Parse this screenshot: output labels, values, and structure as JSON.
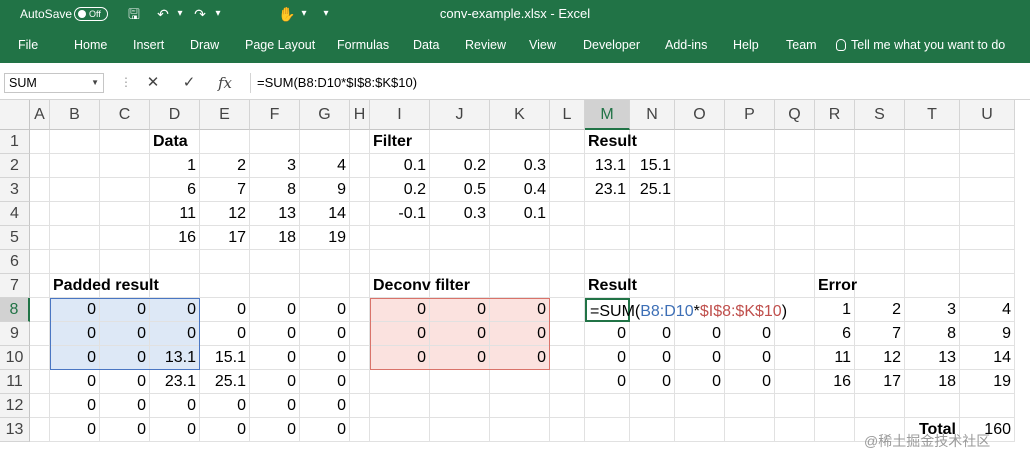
{
  "titlebar": {
    "autosave_label": "AutoSave",
    "autosave_state": "Off",
    "title": "conv-example.xlsx  -  Excel",
    "qat": [
      {
        "name": "save-icon",
        "glyph": "🖫"
      },
      {
        "name": "undo-icon",
        "glyph": "↶"
      },
      {
        "name": "undo-dropdown-icon",
        "glyph": "▾"
      },
      {
        "name": "redo-icon",
        "glyph": "↷"
      },
      {
        "name": "redo-dropdown-icon",
        "glyph": "▾"
      },
      {
        "name": "touch-mode-icon",
        "glyph": "✋"
      },
      {
        "name": "touch-dropdown-icon",
        "glyph": "▾"
      },
      {
        "name": "customize-qat-icon",
        "glyph": "▾"
      }
    ]
  },
  "ribbon": {
    "tabs": [
      "File",
      "Home",
      "Insert",
      "Draw",
      "Page Layout",
      "Formulas",
      "Data",
      "Review",
      "View",
      "Developer",
      "Add-ins",
      "Help",
      "Team"
    ],
    "tellme": "Tell me what you want to do"
  },
  "formula_bar": {
    "name_box": "SUM",
    "cancel_glyph": "✕",
    "enter_glyph": "✓",
    "fx_glyph": "fx",
    "separator": "⋮",
    "formula": "=SUM(B8:D10*$I$8:$K$10)"
  },
  "grid": {
    "columns": [
      "A",
      "B",
      "C",
      "D",
      "E",
      "F",
      "G",
      "H",
      "I",
      "J",
      "K",
      "L",
      "M",
      "N",
      "O",
      "P",
      "Q",
      "R",
      "S",
      "T",
      "U"
    ],
    "selected_column": "M",
    "rows": [
      "1",
      "2",
      "3",
      "4",
      "5",
      "6",
      "7",
      "8",
      "9",
      "10",
      "11",
      "12",
      "13"
    ],
    "selected_row": "8",
    "cells": {
      "D1": "Data",
      "I1": "Filter",
      "M1": "Result",
      "D2": "1",
      "E2": "2",
      "F2": "3",
      "G2": "4",
      "D3": "6",
      "E3": "7",
      "F3": "8",
      "G3": "9",
      "D4": "11",
      "E4": "12",
      "F4": "13",
      "G4": "14",
      "D5": "16",
      "E5": "17",
      "F5": "18",
      "G5": "19",
      "I2": "0.1",
      "J2": "0.2",
      "K2": "0.3",
      "I3": "0.2",
      "J3": "0.5",
      "K3": "0.4",
      "I4": "-0.1",
      "J4": "0.3",
      "K4": "0.1",
      "M2": "13.1",
      "N2": "15.1",
      "M3": "23.1",
      "N3": "25.1",
      "B7": "Padded result",
      "I7": "Deconv filter",
      "M7": "Result",
      "R7": "Error",
      "B8": "0",
      "C8": "0",
      "D8": "0",
      "E8": "0",
      "F8": "0",
      "G8": "0",
      "B9": "0",
      "C9": "0",
      "D9": "0",
      "E9": "0",
      "F9": "0",
      "G9": "0",
      "B10": "0",
      "C10": "0",
      "D10": "13.1",
      "E10": "15.1",
      "F10": "0",
      "G10": "0",
      "B11": "0",
      "C11": "0",
      "D11": "23.1",
      "E11": "25.1",
      "F11": "0",
      "G11": "0",
      "B12": "0",
      "C12": "0",
      "D12": "0",
      "E12": "0",
      "F12": "0",
      "G12": "0",
      "B13": "0",
      "C13": "0",
      "D13": "0",
      "E13": "0",
      "F13": "0",
      "G13": "0",
      "I8": "0",
      "J8": "0",
      "K8": "0",
      "I9": "0",
      "J9": "0",
      "K9": "0",
      "I10": "0",
      "J10": "0",
      "K10": "0",
      "N9": "0",
      "O9": "0",
      "P9": "0",
      "M9": "0",
      "M10": "0",
      "N10": "0",
      "O10": "0",
      "P10": "0",
      "M11": "0",
      "N11": "0",
      "O11": "0",
      "P11": "0",
      "R8": "1",
      "S8": "2",
      "T8": "3",
      "U8": "4",
      "R9": "6",
      "S9": "7",
      "T9": "8",
      "U9": "9",
      "R10": "11",
      "S10": "12",
      "T10": "13",
      "U10": "14",
      "R11": "16",
      "S11": "17",
      "T11": "18",
      "U11": "19",
      "T13": "Total",
      "U13": "160"
    },
    "active_cell": {
      "ref": "M8",
      "parts": [
        "=SUM(",
        "B8:D10",
        "*",
        "$I$8:$K$10",
        ")"
      ]
    }
  },
  "watermark": "@稀土掘金技术社区",
  "colors": {
    "excel_green": "#217346",
    "range1": "#3d6fb6",
    "range2": "#c0504d"
  }
}
